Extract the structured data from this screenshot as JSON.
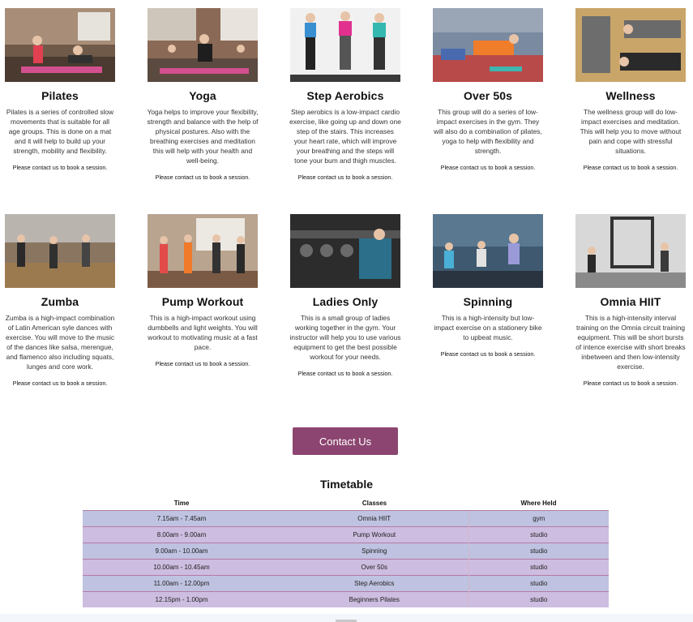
{
  "classes_row1": [
    {
      "title": "Pilates",
      "photo_icon": "pilates-photo",
      "description": "Pilates is a series of controlled slow movements that is suitable for all age groups. This is done on a mat and it will help to build up your strength, mobility and flexibility.",
      "contact": "Please contact us to book a session."
    },
    {
      "title": "Yoga",
      "photo_icon": "yoga-photo",
      "description": "Yoga helps to improve your flexibility, strength and balance with the help of physical postures. Also with the breathing exercises and meditation this will help with your health and well-being.",
      "contact": "Please contact us to book a session."
    },
    {
      "title": "Step Aerobics",
      "photo_icon": "step-aerobics-photo",
      "description": "Step aerobics is a low-impact cardio exercise, like going up and down one step of the stairs. This increases your heart rate, which will improve your breathing and the steps will tone your bum and thigh muscles.",
      "contact": "Please contact us to book a session."
    },
    {
      "title": "Over 50s",
      "photo_icon": "over-50s-photo",
      "description": "This group will do a series of low-impact exercises in the gym. They will also do a combination of pilates, yoga to help with flexibility and strength.",
      "contact": "Please contact us to book a session."
    },
    {
      "title": "Wellness",
      "photo_icon": "wellness-photo",
      "description": "The wellness group will do low-impact exercises and meditation. This will help you to move without pain and cope with stressful situations.",
      "contact": "Please contact us to book a session."
    }
  ],
  "classes_row2": [
    {
      "title": "Zumba",
      "photo_icon": "zumba-photo",
      "description": "Zumba is a high-impact combination of Latin American syle dances with exercise. You will move to the music of the dances like salsa, merengue, and flamenco also including squats, lunges and core work.",
      "contact": "Please contact us to book a session."
    },
    {
      "title": "Pump Workout",
      "photo_icon": "pump-workout-photo",
      "description": "This is a high-impact workout using dumbbells and light weights. You will workout to motivating music at a fast pace.",
      "contact": "Please contact us to book a session."
    },
    {
      "title": "Ladies Only",
      "photo_icon": "ladies-only-photo",
      "description": "This is a small group of ladies working together in the gym. Your instructor will help you to use various equipment to get the best possible workout for your needs.",
      "contact": "Please contact us to book a session."
    },
    {
      "title": "Spinning",
      "photo_icon": "spinning-photo",
      "description": "This is a high-intensity but low-impact exercise on a stationery bike to upbeat music.",
      "contact": "Please contact us to book a session."
    },
    {
      "title": "Omnia HIIT",
      "photo_icon": "omnia-hiit-photo",
      "description": "This is a high-intensity interval training on the Omnia circuit training equipment. This will be short bursts of intence exercise with short breaks inbetween and then low-intensity exercise.",
      "contact": "Please contact us to book a session."
    }
  ],
  "contact_button": "Contact Us",
  "timetable": {
    "title": "Timetable",
    "headers": [
      "Time",
      "Classes",
      "Where Held"
    ],
    "rows": [
      [
        "7.15am - 7.45am",
        "Omnia HIIT",
        "gym"
      ],
      [
        "8.00am - 9.00am",
        "Pump Workout",
        "studio"
      ],
      [
        "9.00am - 10.00am",
        "Spinning",
        "studio"
      ],
      [
        "10.00am - 10.45am",
        "Over 50s",
        "studio"
      ],
      [
        "11.00am - 12.00pm",
        "Step Aerobics",
        "studio"
      ],
      [
        "12.15pm - 1.00pm",
        "Beginners Pilates",
        "studio"
      ]
    ]
  },
  "colors": {
    "button": "#8c4570",
    "row_blue": "#bfc2e0",
    "row_purple": "#cdbde0",
    "row_border": "#b37ba6"
  }
}
